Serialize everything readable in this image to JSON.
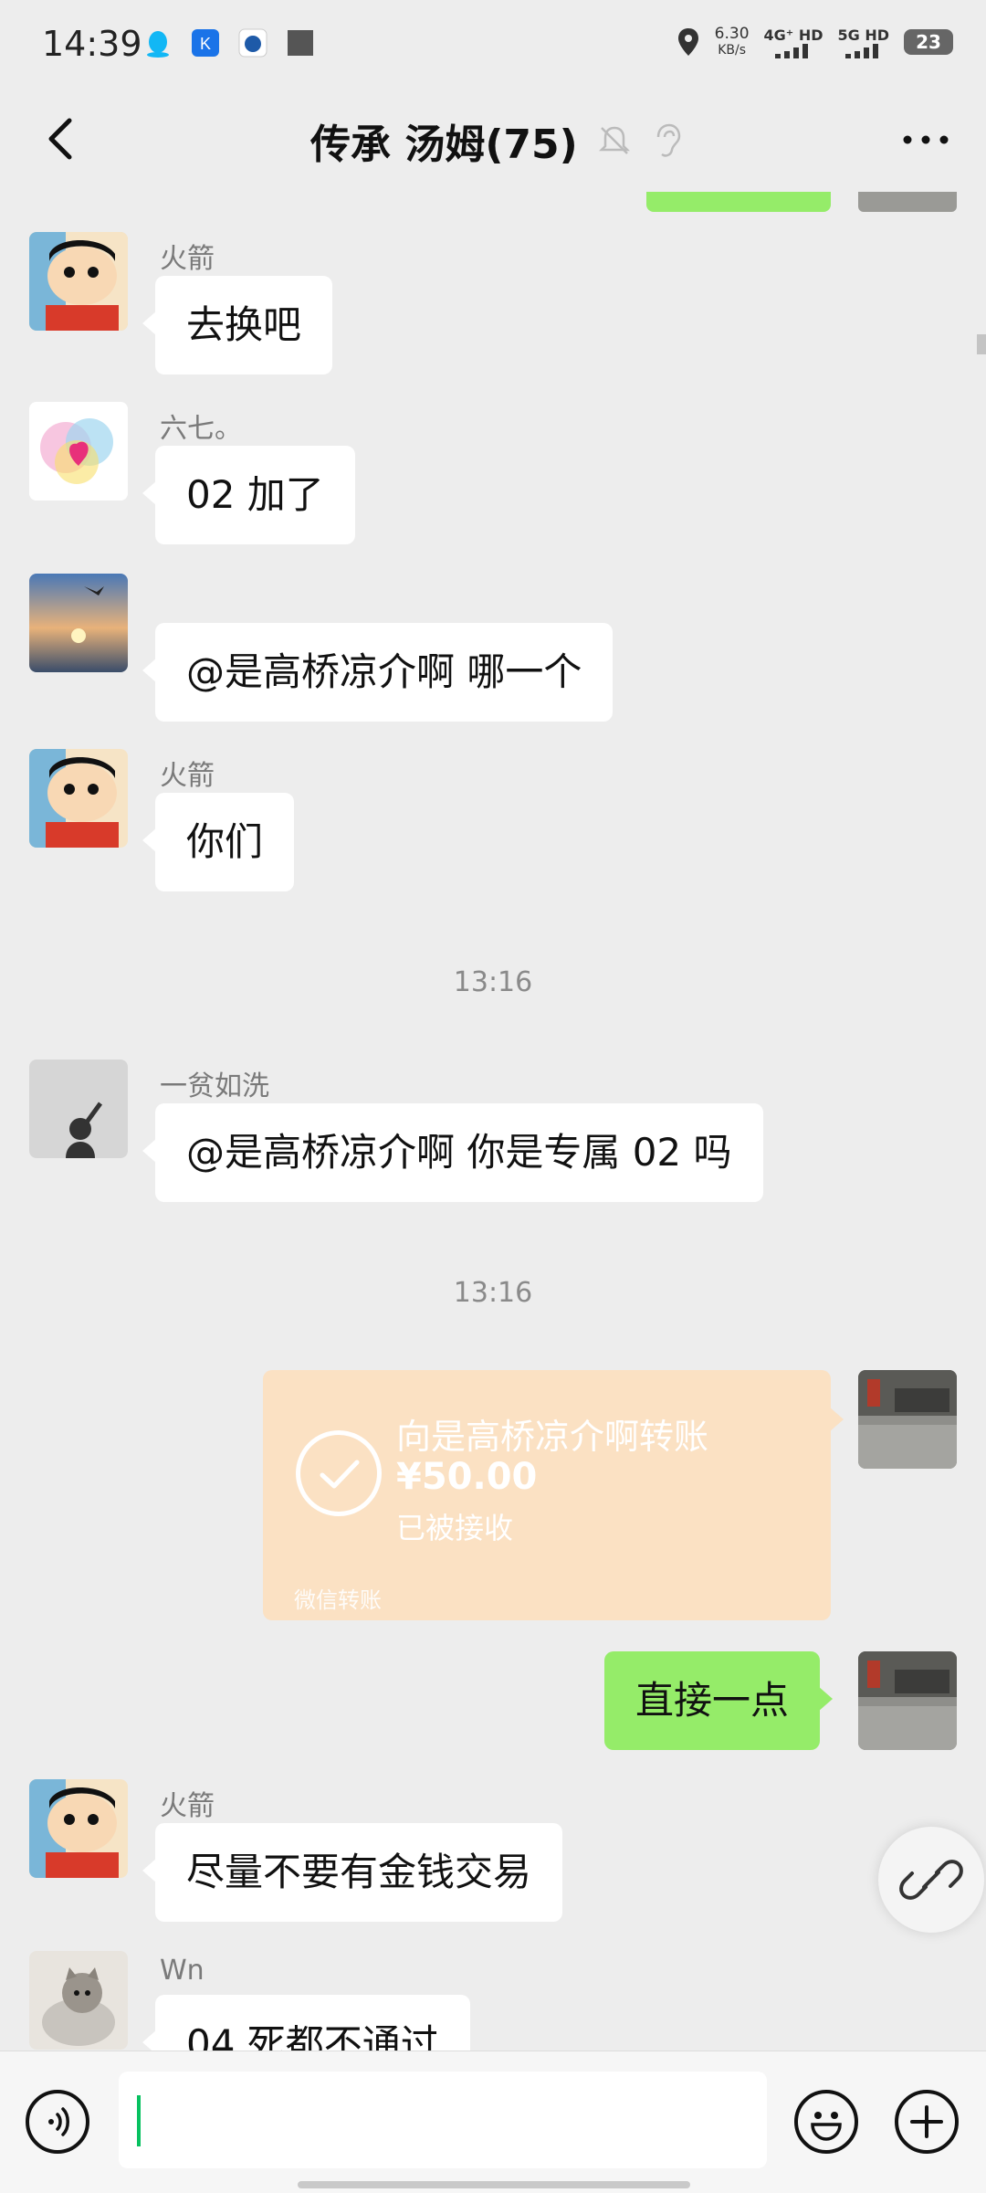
{
  "status_bar": {
    "time": "14:39",
    "net_speed": "6.30",
    "net_unit": "KB/s",
    "sim1": "4G⁺ HD",
    "sim2": "5G HD",
    "battery": "23"
  },
  "header": {
    "title": "传承 汤姆(75)"
  },
  "messages": [
    {
      "sender": "火箭",
      "text": "去换吧"
    },
    {
      "sender": "六七。",
      "text": "02 加了"
    },
    {
      "sender": "",
      "text": "@是高桥凉介啊  哪一个"
    },
    {
      "sender": "火箭",
      "text": "你们"
    },
    {
      "sender": "一贫如洗",
      "text": "@是高桥凉介啊  你是专属 02 吗"
    },
    {
      "sender": "火箭",
      "text": "尽量不要有金钱交易"
    },
    {
      "sender": "Wn",
      "text": "04 死都不通过"
    }
  ],
  "timestamps": [
    "13:16",
    "13:16"
  ],
  "transfer": {
    "title": "向是高桥凉介啊转账",
    "amount": "¥50.00",
    "status": "已被接收",
    "footer": "微信转账"
  },
  "self_message": {
    "text": "直接一点"
  },
  "colors": {
    "self_bubble": "#95ec69",
    "transfer_card": "#fbe1c3",
    "background": "#ededed"
  }
}
